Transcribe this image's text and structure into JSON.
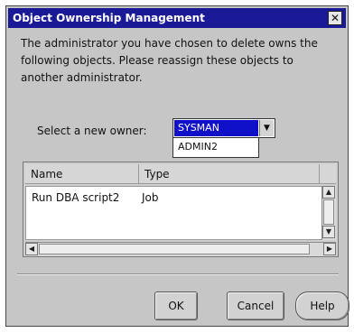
{
  "window": {
    "title": "Object Ownership Management",
    "close_glyph": "✕"
  },
  "message": "The administrator you have chosen to delete owns the following objects. Please reassign these objects to another administrator.",
  "owner_select": {
    "label": "Select a new owner:",
    "value": "SYSMAN",
    "options": [
      "SYSMAN",
      "ADMIN2"
    ]
  },
  "table": {
    "headers": {
      "name": "Name",
      "type": "Type"
    },
    "rows": [
      {
        "name": "Run DBA script2",
        "type": "Job"
      }
    ]
  },
  "scrollbar": {
    "up": "▲",
    "down": "▼",
    "left": "◀",
    "right": "▶"
  },
  "buttons": {
    "ok": "OK",
    "cancel": "Cancel",
    "help": "Help"
  },
  "icons": {
    "close": "close-icon",
    "dropdown": "chevron-down-icon",
    "scroll_up": "arrow-up-icon",
    "scroll_down": "arrow-down-icon",
    "scroll_left": "arrow-left-icon",
    "scroll_right": "arrow-right-icon"
  },
  "colors": {
    "titlebar": "#1a1a96",
    "selection": "#1010c8",
    "dialog_bg": "#c6c6c6"
  }
}
